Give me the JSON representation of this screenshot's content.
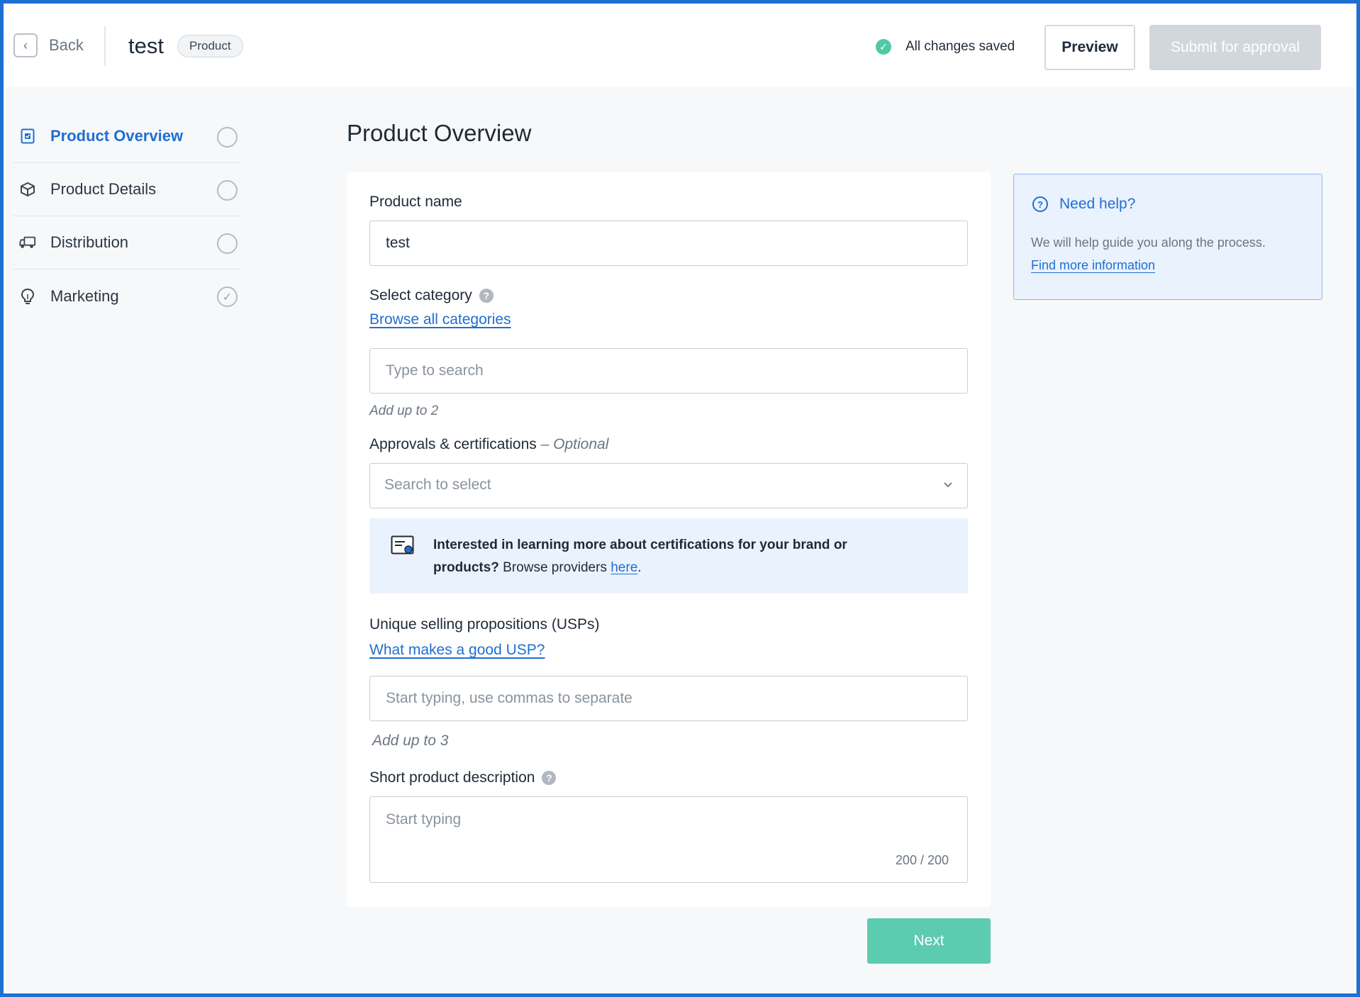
{
  "header": {
    "back_label": "Back",
    "title": "test",
    "type_badge": "Product",
    "saved_status": "All changes saved",
    "preview_label": "Preview",
    "submit_label": "Submit for approval"
  },
  "sidebar": {
    "items": [
      {
        "label": "Product Overview",
        "icon": "document-icon",
        "status": "incomplete",
        "active": true
      },
      {
        "label": "Product Details",
        "icon": "box-icon",
        "status": "incomplete",
        "active": false
      },
      {
        "label": "Distribution",
        "icon": "truck-icon",
        "status": "incomplete",
        "active": false
      },
      {
        "label": "Marketing",
        "icon": "lightbulb-icon",
        "status": "complete",
        "active": false
      }
    ]
  },
  "main": {
    "heading": "Product Overview",
    "product_name": {
      "label": "Product name",
      "value": "test"
    },
    "category": {
      "label": "Select category",
      "browse_link": "Browse all categories",
      "placeholder": "Type to search",
      "hint": "Add up to 2"
    },
    "approvals": {
      "label": "Approvals & certifications",
      "optional": "– Optional",
      "placeholder": "Search to select",
      "info_bold": "Interested in learning more about certifications for your brand or products?",
      "info_text": "Browse providers",
      "info_link": "here",
      "info_end": "."
    },
    "usps": {
      "label": "Unique selling propositions (USPs)",
      "link": "What makes a good USP?",
      "placeholder": "Start typing, use commas to separate",
      "hint": "Add up to 3"
    },
    "description": {
      "label": "Short product description",
      "placeholder": "Start typing",
      "counter": "200 / 200"
    },
    "next_label": "Next"
  },
  "help": {
    "title": "Need help?",
    "text": "We will help guide you along the process.",
    "link": "Find more information"
  },
  "colors": {
    "accent": "#1f6fd1",
    "success": "#53c8a6",
    "next_button": "#5ccbb0",
    "disabled": "#d2d7dd"
  }
}
